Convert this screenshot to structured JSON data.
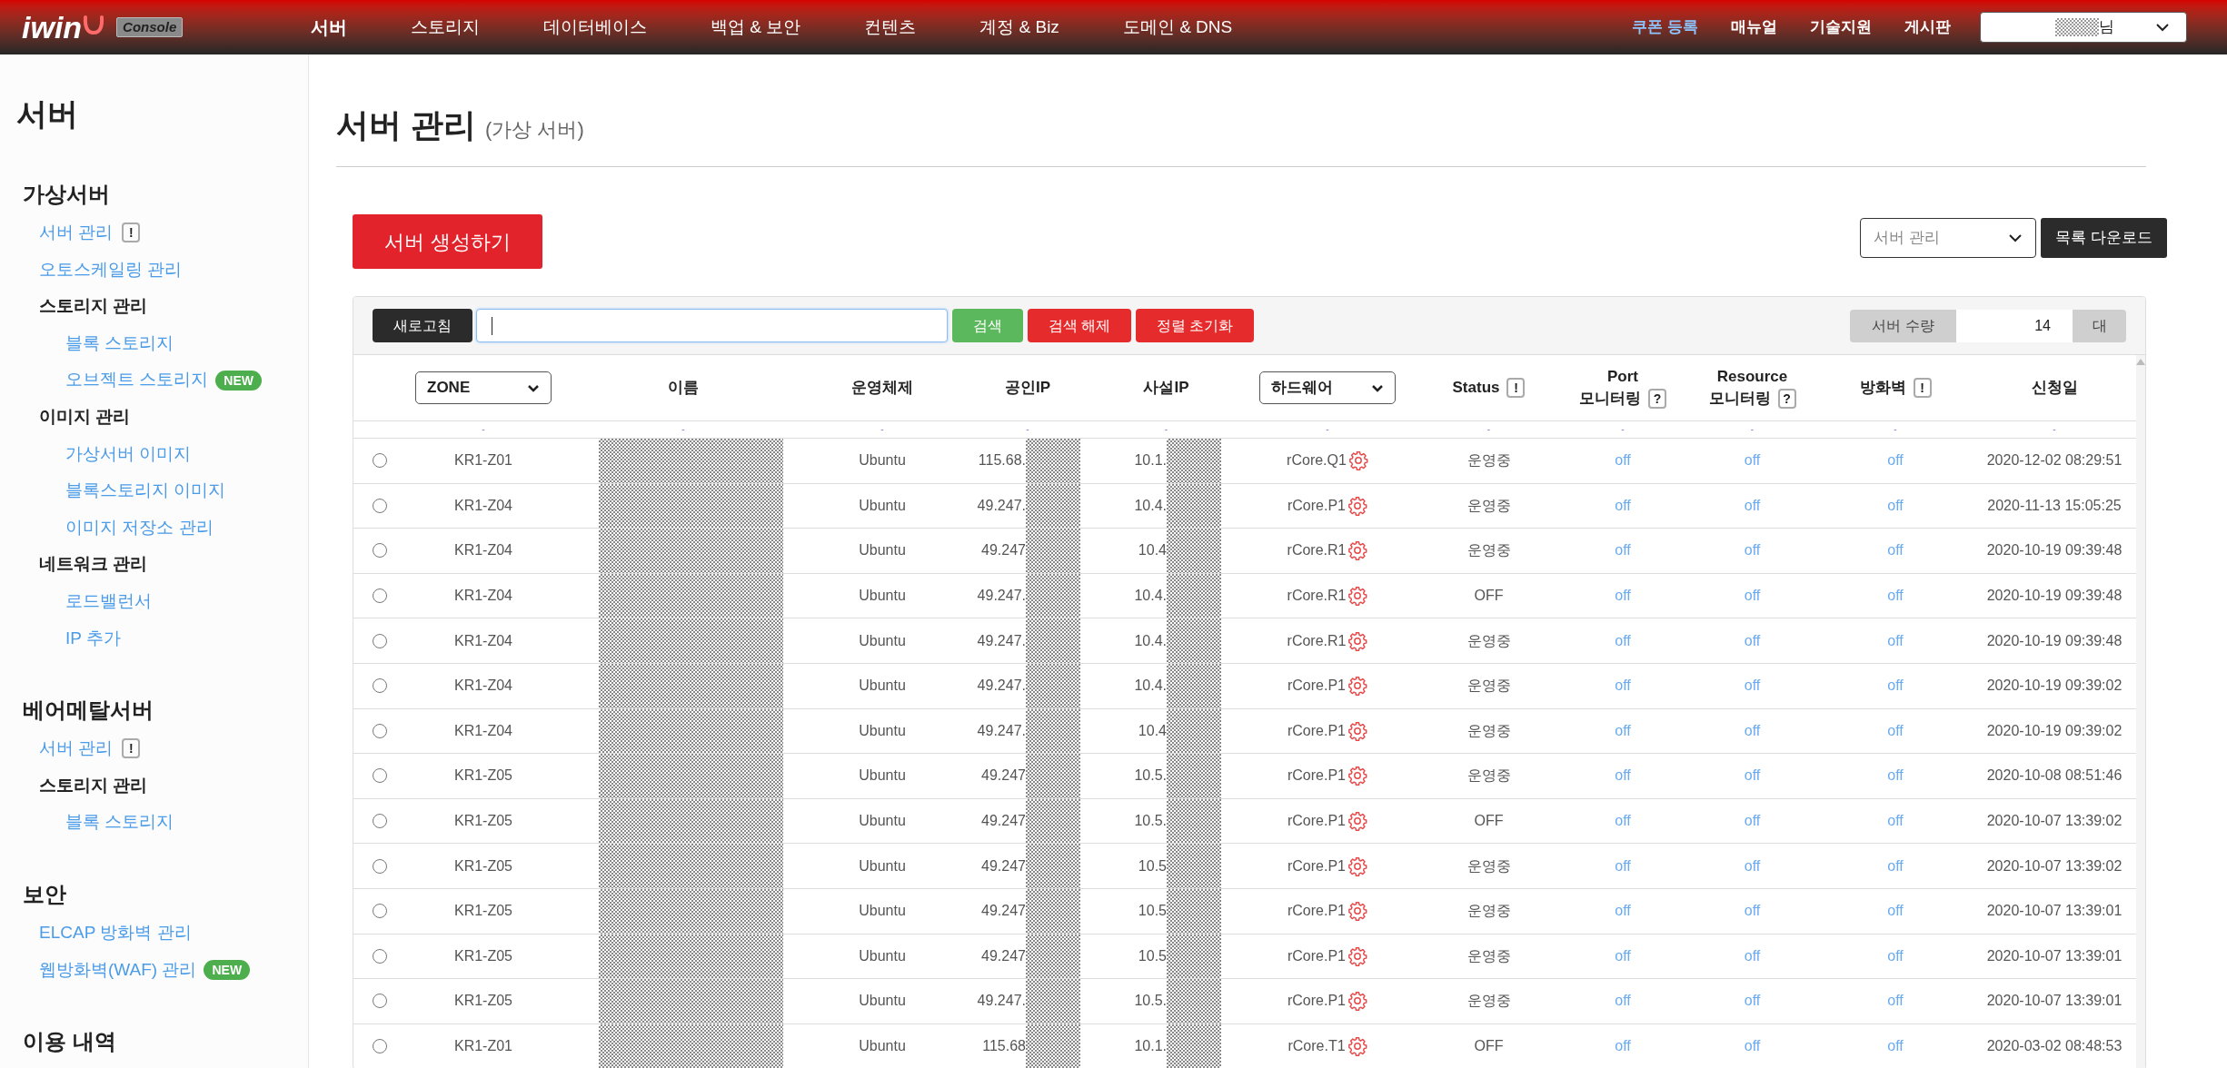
{
  "header": {
    "logo": "iwin",
    "logo_badge": "Console",
    "nav": [
      {
        "label": "서버",
        "selected": true
      },
      {
        "label": "스토리지",
        "selected": false
      },
      {
        "label": "데이터베이스",
        "selected": false
      },
      {
        "label": "백업 & 보안",
        "selected": false
      },
      {
        "label": "컨텐츠",
        "selected": false
      },
      {
        "label": "계정 & Biz",
        "selected": false
      },
      {
        "label": "도메인 & DNS",
        "selected": false
      }
    ],
    "links": [
      {
        "label": "쿠폰 등록",
        "kind": "accent"
      },
      {
        "label": "매뉴얼",
        "kind": "plain"
      },
      {
        "label": "기술지원",
        "kind": "plain"
      },
      {
        "label": "게시판",
        "kind": "plain"
      }
    ],
    "user_menu": {
      "suffix": "님"
    }
  },
  "sidebar": {
    "title": "서버",
    "sections": [
      {
        "title": "가상서버",
        "items": [
          {
            "label": "서버 관리",
            "kind": "link",
            "badge": {
              "kind": "info",
              "text": "!"
            }
          },
          {
            "label": "오토스케일링 관리",
            "kind": "link"
          },
          {
            "label": "스토리지 관리",
            "kind": "group",
            "children": [
              {
                "label": "블록 스토리지",
                "kind": "link"
              },
              {
                "label": "오브젝트 스토리지",
                "kind": "link",
                "badge": {
                  "kind": "new",
                  "text": "NEW"
                }
              }
            ]
          },
          {
            "label": "이미지 관리",
            "kind": "group",
            "children": [
              {
                "label": "가상서버 이미지",
                "kind": "link"
              },
              {
                "label": "블록스토리지 이미지",
                "kind": "link"
              },
              {
                "label": "이미지 저장소 관리",
                "kind": "link"
              }
            ]
          },
          {
            "label": "네트워크 관리",
            "kind": "group",
            "children": [
              {
                "label": "로드밸런서",
                "kind": "link"
              },
              {
                "label": "IP 추가",
                "kind": "link"
              }
            ]
          }
        ]
      },
      {
        "title": "베어메탈서버",
        "items": [
          {
            "label": "서버 관리",
            "kind": "link",
            "badge": {
              "kind": "info",
              "text": "!"
            }
          },
          {
            "label": "스토리지 관리",
            "kind": "group",
            "children": [
              {
                "label": "블록 스토리지",
                "kind": "link"
              }
            ]
          }
        ]
      },
      {
        "title": "보안",
        "items": [
          {
            "label": "ELCAP 방화벽 관리",
            "kind": "link"
          },
          {
            "label": "웹방화벽(WAF) 관리",
            "kind": "link",
            "badge": {
              "kind": "new",
              "text": "NEW"
            }
          }
        ]
      },
      {
        "title": "이용 내역"
      }
    ]
  },
  "page": {
    "title": "서버 관리",
    "subtitle": "(가상 서버)",
    "create_button": "서버 생성하기",
    "view_select": "서버 관리",
    "download_button": "목록 다운로드"
  },
  "toolbar": {
    "refresh": "새로고침",
    "search": "검색",
    "clear": "검색 해제",
    "reset": "정렬 초기화",
    "count_label": "서버 수량",
    "count": "14",
    "count_unit": "대"
  },
  "table": {
    "columns": [
      {
        "lines": [
          "ZONE"
        ],
        "kind": "select"
      },
      {
        "lines": [
          "이름"
        ],
        "kind": "text"
      },
      {
        "lines": [
          "운영체제"
        ],
        "kind": "text"
      },
      {
        "lines": [
          "공인IP"
        ],
        "kind": "text"
      },
      {
        "lines": [
          "사설IP"
        ],
        "kind": "text"
      },
      {
        "lines": [
          "하드웨어"
        ],
        "kind": "select"
      },
      {
        "lines": [
          "Status"
        ],
        "kind": "text",
        "help": "!"
      },
      {
        "lines": [
          "Port",
          "모니터링"
        ],
        "kind": "text",
        "help": "?"
      },
      {
        "lines": [
          "Resource",
          "모니터링"
        ],
        "kind": "text",
        "help": "?"
      },
      {
        "lines": [
          "방화벽"
        ],
        "kind": "text",
        "help": "!"
      },
      {
        "lines": [
          "신청일"
        ],
        "kind": "text"
      }
    ],
    "filter_row": [
      "-",
      "-",
      "-",
      "-",
      "-",
      "-",
      "-",
      "-",
      "-",
      "-",
      "-"
    ],
    "rows": [
      {
        "selected": false,
        "zone": "KR1-Z01",
        "os": "Ubuntu",
        "public_ip": "115.68.",
        "private_ip": "10.1.",
        "hardware": "rCore.Q1",
        "status": "운영중",
        "port": "off",
        "resource": "off",
        "firewall": "off",
        "date": "2020-12-02 08:29:51"
      },
      {
        "selected": false,
        "zone": "KR1-Z04",
        "os": "Ubuntu",
        "public_ip": "49.247.",
        "private_ip": "10.4.",
        "hardware": "rCore.P1",
        "status": "운영중",
        "port": "off",
        "resource": "off",
        "firewall": "off",
        "date": "2020-11-13 15:05:25"
      },
      {
        "selected": false,
        "zone": "KR1-Z04",
        "os": "Ubuntu",
        "public_ip": "49.247",
        "private_ip": "10.4",
        "hardware": "rCore.R1",
        "status": "운영중",
        "port": "off",
        "resource": "off",
        "firewall": "off",
        "date": "2020-10-19 09:39:48"
      },
      {
        "selected": false,
        "zone": "KR1-Z04",
        "os": "Ubuntu",
        "public_ip": "49.247.",
        "private_ip": "10.4.",
        "hardware": "rCore.R1",
        "status": "OFF",
        "port": "off",
        "resource": "off",
        "firewall": "off",
        "date": "2020-10-19 09:39:48"
      },
      {
        "selected": false,
        "zone": "KR1-Z04",
        "os": "Ubuntu",
        "public_ip": "49.247.",
        "private_ip": "10.4.",
        "hardware": "rCore.R1",
        "status": "운영중",
        "port": "off",
        "resource": "off",
        "firewall": "off",
        "date": "2020-10-19 09:39:48"
      },
      {
        "selected": false,
        "zone": "KR1-Z04",
        "os": "Ubuntu",
        "public_ip": "49.247.",
        "private_ip": "10.4.",
        "hardware": "rCore.P1",
        "status": "운영중",
        "port": "off",
        "resource": "off",
        "firewall": "off",
        "date": "2020-10-19 09:39:02"
      },
      {
        "selected": false,
        "zone": "KR1-Z04",
        "os": "Ubuntu",
        "public_ip": "49.247.",
        "private_ip": "10.4",
        "hardware": "rCore.P1",
        "status": "운영중",
        "port": "off",
        "resource": "off",
        "firewall": "off",
        "date": "2020-10-19 09:39:02"
      },
      {
        "selected": false,
        "zone": "KR1-Z05",
        "os": "Ubuntu",
        "public_ip": "49.247",
        "private_ip": "10.5.",
        "hardware": "rCore.P1",
        "status": "운영중",
        "port": "off",
        "resource": "off",
        "firewall": "off",
        "date": "2020-10-08 08:51:46"
      },
      {
        "selected": false,
        "zone": "KR1-Z05",
        "os": "Ubuntu",
        "public_ip": "49.247",
        "private_ip": "10.5.",
        "hardware": "rCore.P1",
        "status": "OFF",
        "port": "off",
        "resource": "off",
        "firewall": "off",
        "date": "2020-10-07 13:39:02"
      },
      {
        "selected": false,
        "zone": "KR1-Z05",
        "os": "Ubuntu",
        "public_ip": "49.247",
        "private_ip": "10.5",
        "hardware": "rCore.P1",
        "status": "운영중",
        "port": "off",
        "resource": "off",
        "firewall": "off",
        "date": "2020-10-07 13:39:02"
      },
      {
        "selected": false,
        "zone": "KR1-Z05",
        "os": "Ubuntu",
        "public_ip": "49.247",
        "private_ip": "10.5",
        "hardware": "rCore.P1",
        "status": "운영중",
        "port": "off",
        "resource": "off",
        "firewall": "off",
        "date": "2020-10-07 13:39:01"
      },
      {
        "selected": false,
        "zone": "KR1-Z05",
        "os": "Ubuntu",
        "public_ip": "49.247",
        "private_ip": "10.5",
        "hardware": "rCore.P1",
        "status": "운영중",
        "port": "off",
        "resource": "off",
        "firewall": "off",
        "date": "2020-10-07 13:39:01"
      },
      {
        "selected": false,
        "zone": "KR1-Z05",
        "os": "Ubuntu",
        "public_ip": "49.247.",
        "private_ip": "10.5.",
        "hardware": "rCore.P1",
        "status": "운영중",
        "port": "off",
        "resource": "off",
        "firewall": "off",
        "date": "2020-10-07 13:39:01"
      },
      {
        "selected": false,
        "zone": "KR1-Z01",
        "os": "Ubuntu",
        "public_ip": "115.68",
        "private_ip": "10.1.",
        "hardware": "rCore.T1",
        "status": "OFF",
        "port": "off",
        "resource": "off",
        "firewall": "off",
        "date": "2020-03-02 08:48:53"
      }
    ]
  }
}
